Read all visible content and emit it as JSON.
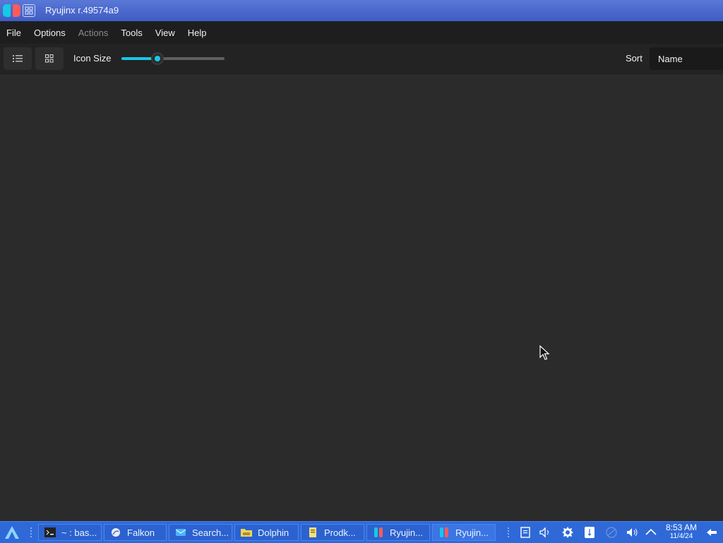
{
  "window": {
    "title": "Ryujinx r.49574a9"
  },
  "menu": [
    {
      "label": "File",
      "enabled": true
    },
    {
      "label": "Options",
      "enabled": true
    },
    {
      "label": "Actions",
      "enabled": false
    },
    {
      "label": "Tools",
      "enabled": true
    },
    {
      "label": "View",
      "enabled": true
    },
    {
      "label": "Help",
      "enabled": true
    }
  ],
  "toolbar": {
    "list_view_icon": "list-icon",
    "grid_view_icon": "grid-icon",
    "icon_size_label": "Icon Size",
    "icon_size_value": 0.35,
    "sort_label": "Sort",
    "sort_value": "Name"
  },
  "colors": {
    "accent": "#19c7e6",
    "brand_red": "#ff5b5b",
    "taskbar": "#2f69d8"
  },
  "taskbar": {
    "tasks": [
      {
        "label": "~ : bas...",
        "icon": "terminal-icon"
      },
      {
        "label": "Falkon",
        "icon": "falkon-icon"
      },
      {
        "label": "Search...",
        "icon": "search-app-icon"
      },
      {
        "label": "Dolphin",
        "icon": "folder-icon"
      },
      {
        "label": "Prodk...",
        "icon": "document-icon"
      },
      {
        "label": "Ryujin...",
        "icon": "ryujinx-icon"
      },
      {
        "label": "Ryujin...",
        "icon": "ryujinx-icon"
      }
    ],
    "time": "8:53 AM",
    "date": "11/4/24"
  }
}
